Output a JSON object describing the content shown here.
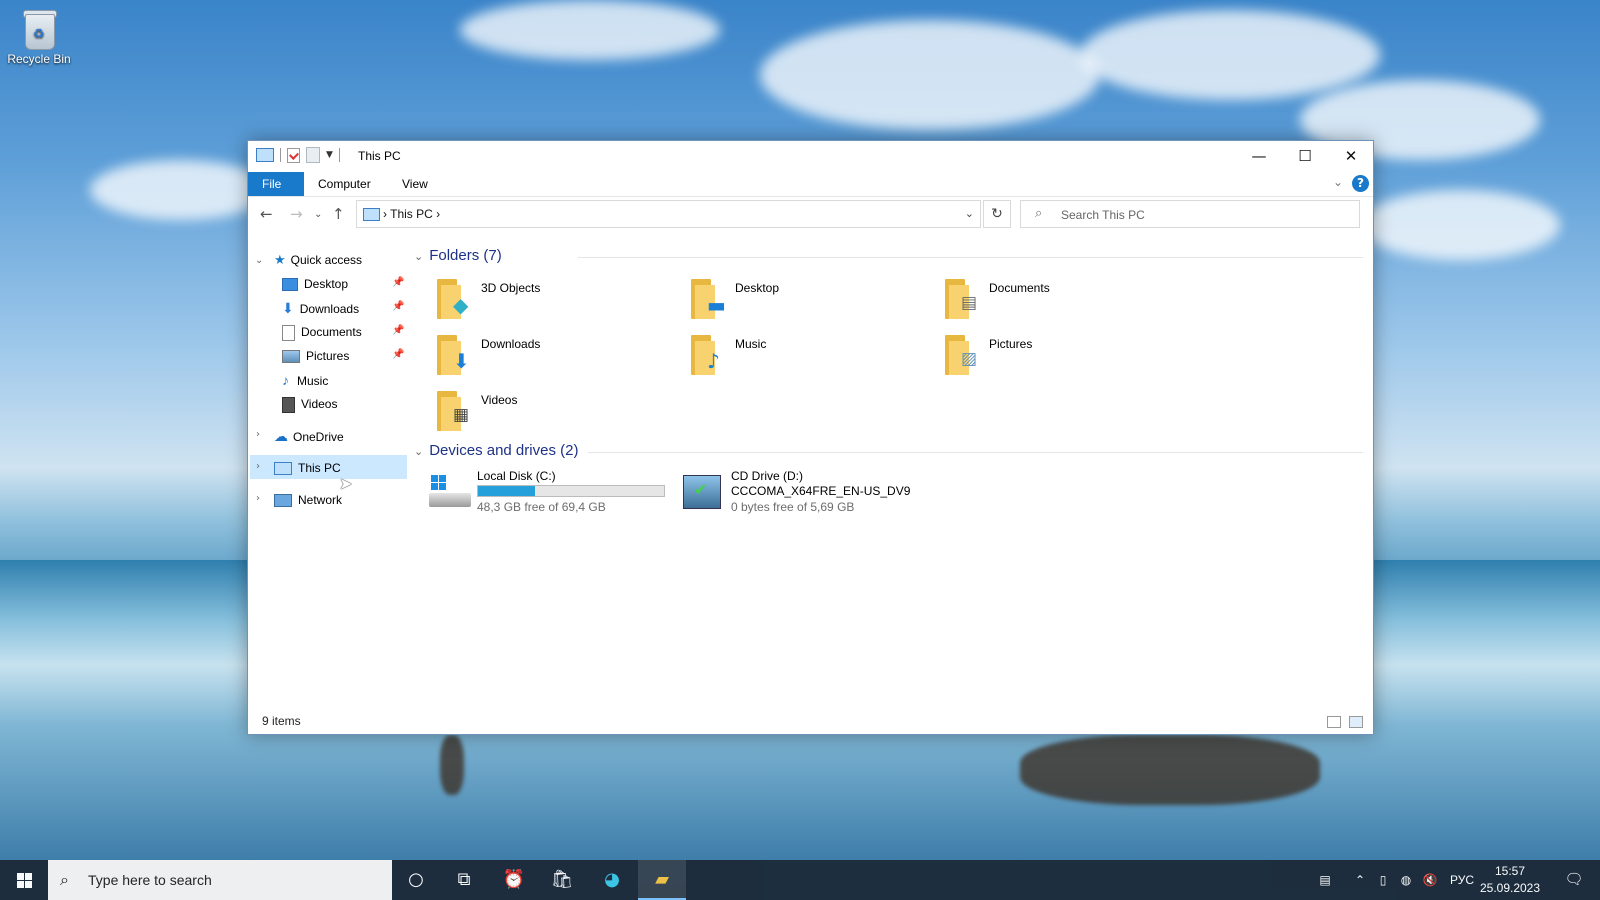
{
  "desktop": {
    "recycle_bin_label": "Recycle Bin"
  },
  "window": {
    "title": "This PC",
    "controls": {
      "minimize": "—",
      "maximize": "☐",
      "close": "✕"
    },
    "ribbon_tabs": [
      "File",
      "Computer",
      "View"
    ],
    "help_label": "?",
    "address": {
      "crumb": "This PC"
    },
    "search": {
      "placeholder": "Search This PC"
    },
    "nav": {
      "quick_access": "Quick access",
      "quick_items": [
        "Desktop",
        "Downloads",
        "Documents",
        "Pictures",
        "Music",
        "Videos"
      ],
      "onedrive": "OneDrive",
      "this_pc": "This PC",
      "network": "Network"
    },
    "folders": {
      "heading": "Folders (7)",
      "items": [
        "3D Objects",
        "Desktop",
        "Documents",
        "Downloads",
        "Music",
        "Pictures",
        "Videos"
      ]
    },
    "drives": {
      "heading": "Devices and drives (2)",
      "items": [
        {
          "name": "Local Disk (C:)",
          "free": "48,3 GB free of 69,4 GB",
          "used_fraction": 0.304
        },
        {
          "name": "CD Drive (D:)",
          "label": "CCCOMA_X64FRE_EN-US_DV9",
          "free": "0 bytes free of 5,69 GB"
        }
      ]
    },
    "status": "9 items"
  },
  "taskbar": {
    "search_placeholder": "Type here to search",
    "language": "РУС",
    "time": "15:57",
    "date": "25.09.2023"
  },
  "colors": {
    "accent": "#1979ca",
    "selection": "#cce8ff",
    "drive_bar": "#26a0da"
  }
}
